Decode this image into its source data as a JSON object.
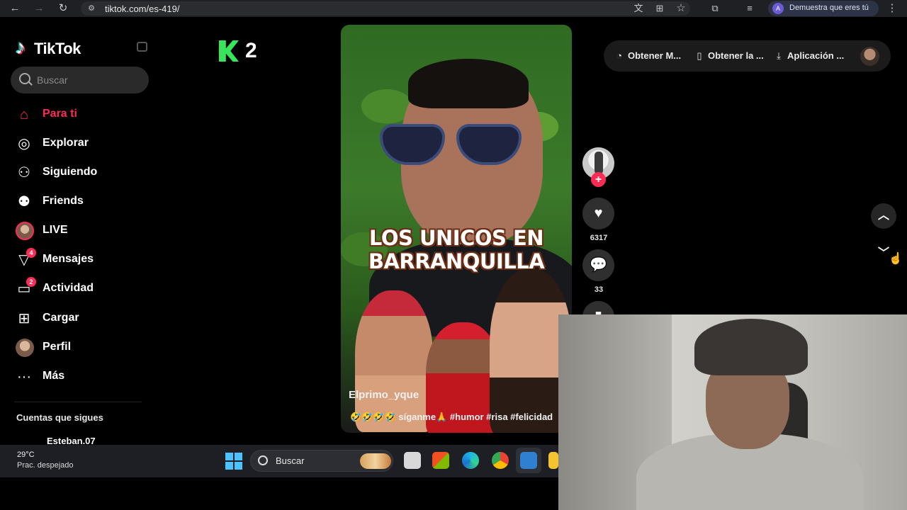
{
  "browser": {
    "url": "tiktok.com/es-419/",
    "profile_chip_label": "Demuestra que eres tú",
    "profile_initial": "A"
  },
  "sidebar": {
    "logo_text": "TikTok",
    "search_placeholder": "Buscar",
    "items": [
      {
        "label": "Para ti",
        "icon": "home-icon",
        "active": true
      },
      {
        "label": "Explorar",
        "icon": "compass-icon"
      },
      {
        "label": "Siguiendo",
        "icon": "following-icon"
      },
      {
        "label": "Friends",
        "icon": "friends-icon"
      },
      {
        "label": "LIVE",
        "icon": "live-icon"
      },
      {
        "label": "Mensajes",
        "icon": "messages-icon",
        "badge": "4"
      },
      {
        "label": "Actividad",
        "icon": "activity-icon",
        "badge": "2"
      },
      {
        "label": "Cargar",
        "icon": "upload-icon"
      },
      {
        "label": "Perfil",
        "icon": "profile-icon"
      },
      {
        "label": "Más",
        "icon": "more-icon"
      }
    ],
    "following_section_title": "Cuentas que sigues",
    "following_accounts": [
      "Esteban.07"
    ]
  },
  "streak": {
    "count": "2"
  },
  "video": {
    "overlay_title": "LOS UNICOS EN BARRANQUILLA",
    "author": "Elprimo_yque",
    "caption": "🤣🤣🤣🤣 síganme🙏 #humor #risa #felicidad"
  },
  "actions": {
    "like_count": "6317",
    "comment_count": "33"
  },
  "header": {
    "items": [
      {
        "label": "Obtener M...",
        "icon": "coin-icon"
      },
      {
        "label": "Obtener la ...",
        "icon": "phone-icon"
      },
      {
        "label": "Aplicación ...",
        "icon": "download-icon"
      }
    ]
  },
  "taskbar": {
    "temperature": "29°C",
    "weather": "Prac. despejado",
    "search_label": "Buscar"
  },
  "colors": {
    "accent": "#fe2c55",
    "streak_green": "#37e65b",
    "background": "#000000"
  }
}
